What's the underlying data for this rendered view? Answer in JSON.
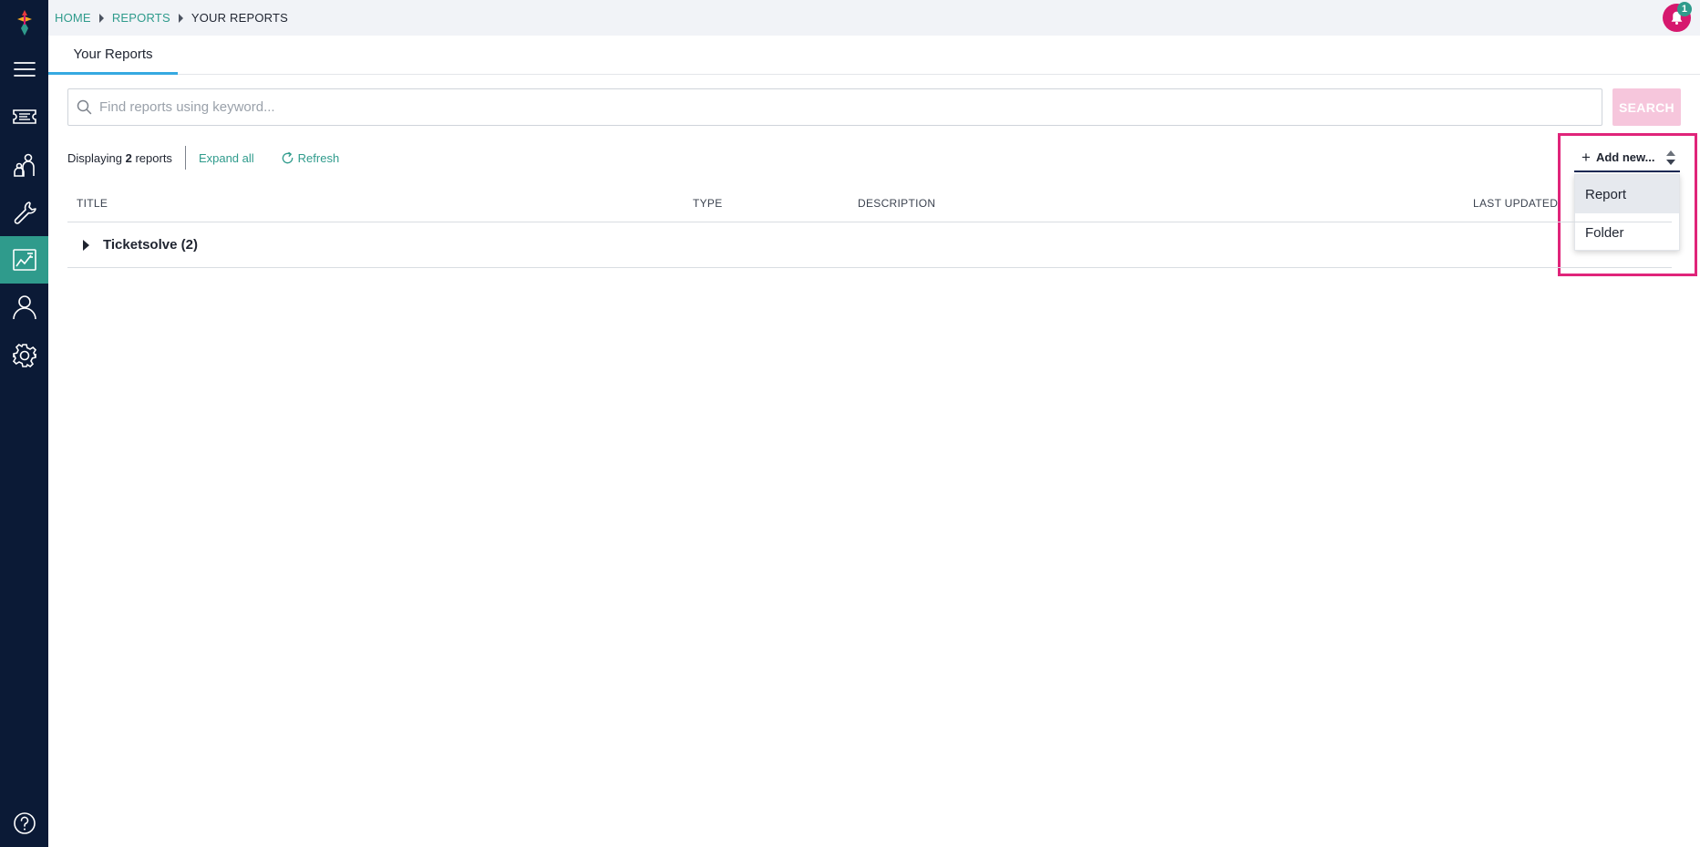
{
  "breadcrumb": {
    "items": [
      {
        "label": "HOME"
      },
      {
        "label": "REPORTS"
      },
      {
        "label": "YOUR REPORTS"
      }
    ]
  },
  "notifications": {
    "count": "1",
    "icon": "bell-icon"
  },
  "sidebar": {
    "items": [
      {
        "name": "menu",
        "icon": "hamburger-icon"
      },
      {
        "name": "tickets",
        "icon": "ticket-icon"
      },
      {
        "name": "customers",
        "icon": "people-icon"
      },
      {
        "name": "tools",
        "icon": "wrench-icon"
      },
      {
        "name": "reports",
        "icon": "report-chart-icon",
        "active": true
      },
      {
        "name": "account",
        "icon": "user-icon"
      },
      {
        "name": "settings",
        "icon": "gear-icon"
      },
      {
        "name": "help",
        "icon": "help-icon"
      }
    ],
    "active_color": "#2f9b8c",
    "background": "#0b1a36"
  },
  "tabs": [
    {
      "label": "Your Reports",
      "active": true
    }
  ],
  "search": {
    "placeholder": "Find reports using keyword...",
    "value": "",
    "button_label": "SEARCH"
  },
  "toolbar": {
    "display_prefix": "Displaying",
    "display_count": "2",
    "display_suffix": "reports",
    "expand_all_label": "Expand all",
    "refresh_label": "Refresh"
  },
  "add_new": {
    "label": "Add new...",
    "options": [
      {
        "label": "Report"
      },
      {
        "label": "Folder"
      }
    ]
  },
  "table": {
    "columns": [
      "TITLE",
      "TYPE",
      "DESCRIPTION",
      "LAST UPDATED"
    ],
    "rows": [
      {
        "title": "Ticketsolve (2)"
      }
    ]
  },
  "colors": {
    "accent": "#2f9b8c",
    "brand_pink": "#d6186e",
    "tab_underline": "#36a9e1",
    "highlight": "#e0247a"
  }
}
